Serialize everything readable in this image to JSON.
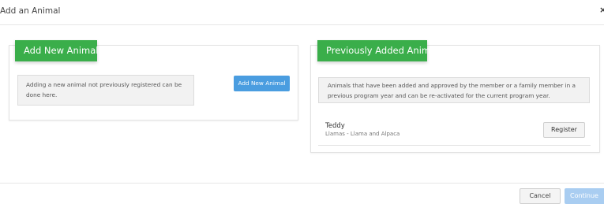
{
  "modal": {
    "title": "Add an Animal",
    "close_glyph": "×"
  },
  "add_panel": {
    "heading": "Add New Animal",
    "description": "Adding a new animal not previously registered can be done here.",
    "button_label": "Add New Animal"
  },
  "previous_panel": {
    "heading": "Previously Added Animals",
    "description": "Animals that have been added and approved by the member or a family member in a previous program year and can be re-activated for the current program year.",
    "animals": [
      {
        "name": "Teddy",
        "type": "Llamas - Llama and Alpaca",
        "action_label": "Register"
      }
    ]
  },
  "footer": {
    "cancel_label": "Cancel",
    "continue_label": "Continue"
  },
  "colors": {
    "heading_green": "#3aae4a",
    "primary_blue": "#4a9de0",
    "disabled_blue": "#a9cdf1"
  }
}
